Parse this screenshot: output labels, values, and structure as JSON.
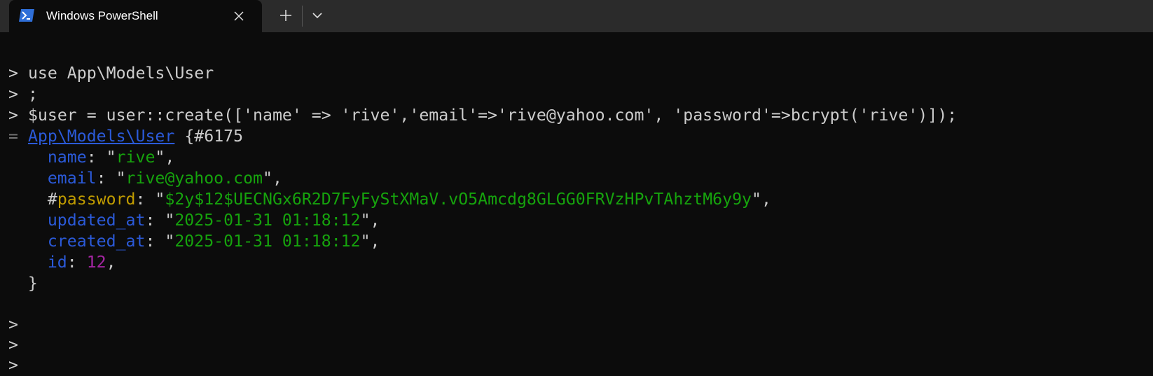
{
  "window": {
    "tab_title": "Windows PowerShell",
    "tab_icon": "powershell-icon",
    "close_icon": "close-icon",
    "new_tab_icon": "plus-icon",
    "dropdown_icon": "chevron-down-icon"
  },
  "terminal": {
    "prompt": ">",
    "result_marker": "=",
    "lines": {
      "l1": "use App\\Models\\User",
      "l2": ";",
      "l3": "$user = user::create(['name' => 'rive','email'=>'rive@yahoo.com', 'password'=>bcrypt('rive')]);",
      "l4_class": "App\\Models\\User",
      "l4_rest": "{#6175",
      "close_brace": "}"
    },
    "fields": {
      "name_key": "name",
      "name_val": "rive",
      "email_key": "email",
      "email_val": "rive@yahoo.com",
      "password_hash": "#",
      "password_key": "password",
      "password_val": "$2y$12$UECNGx6R2D7FyFyStXMaV.vO5Amcdg8GLGG0FRVzHPvTAhztM6y9y",
      "updated_key": "updated_at",
      "updated_val": "2025-01-31 01:18:12",
      "created_key": "created_at",
      "created_val": "2025-01-31 01:18:12",
      "id_key": "id",
      "id_val": "12"
    },
    "punct": {
      "colon": ": ",
      "quote": "\"",
      "quote_comma": "\",",
      "comma": ","
    }
  },
  "colors": {
    "background": "#0c0c0c",
    "titlebar": "#2b2b2b",
    "key": "#2b5ad9",
    "string": "#16a30d",
    "protected": "#c19c00",
    "number": "#a626a4"
  }
}
